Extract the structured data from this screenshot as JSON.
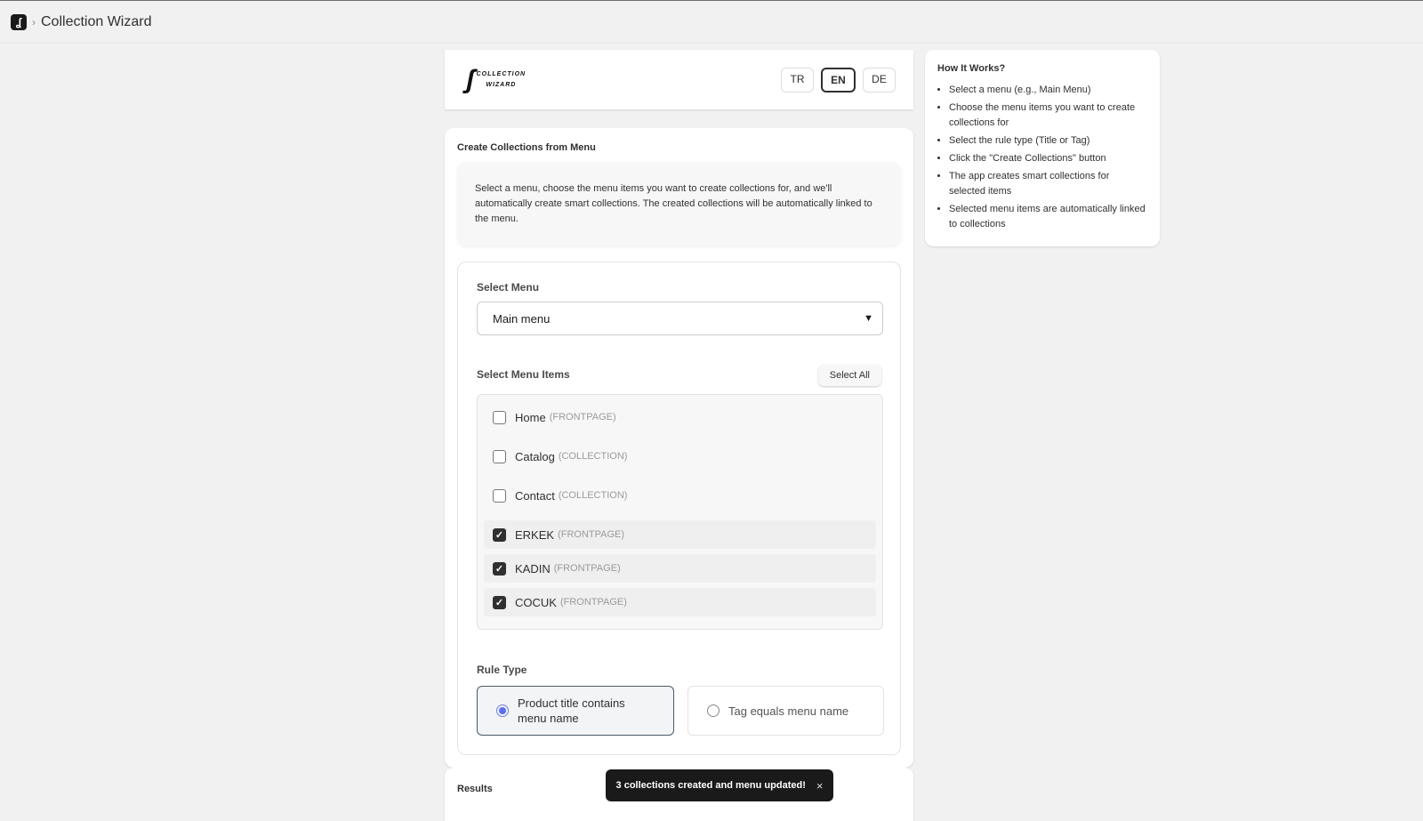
{
  "header": {
    "breadcrumb_chevron": "›",
    "title": "Collection Wizard",
    "app_icon": "wizard-icon"
  },
  "logo": {
    "line1": "COLLECTION",
    "line2": "WIZARD"
  },
  "languages": [
    {
      "label": "TR"
    },
    {
      "label": "EN",
      "active": true
    },
    {
      "label": "DE"
    }
  ],
  "main": {
    "title": "Create Collections from Menu",
    "description": "Select a menu, choose the menu items you want to create collections for, and we'll automatically create smart collections. The created collections will be automatically linked to the menu.",
    "select_menu_label": "Select Menu",
    "select_menu_value": "Main menu",
    "menu_items_label": "Select Menu Items",
    "select_all_label": "Select All",
    "items": [
      {
        "name": "Home",
        "type": "(FRONTPAGE)",
        "checked": false
      },
      {
        "name": "Catalog",
        "type": "(COLLECTION)",
        "checked": false
      },
      {
        "name": "Contact",
        "type": "(COLLECTION)",
        "checked": false
      },
      {
        "name": "ERKEK",
        "type": "(FRONTPAGE)",
        "checked": true
      },
      {
        "name": "KADIN",
        "type": "(FRONTPAGE)",
        "checked": true
      },
      {
        "name": "COCUK",
        "type": "(FRONTPAGE)",
        "checked": true
      }
    ],
    "rule_type_label": "Rule Type",
    "rule_options": [
      {
        "label": "Product title contains menu name",
        "selected": true
      },
      {
        "label": "Tag equals menu name",
        "selected": false
      }
    ]
  },
  "results": {
    "title": "Results"
  },
  "how_it_works": {
    "title": "How It Works?",
    "steps": [
      "Select a menu (e.g., Main Menu)",
      "Choose the menu items you want to create collections for",
      "Select the rule type (Title or Tag)",
      "Click the \"Create Collections\" button",
      "The app creates smart collections for selected items",
      "Selected menu items are automatically linked to collections"
    ]
  },
  "toast": {
    "message": "3 collections created and menu updated!",
    "close": "×"
  }
}
